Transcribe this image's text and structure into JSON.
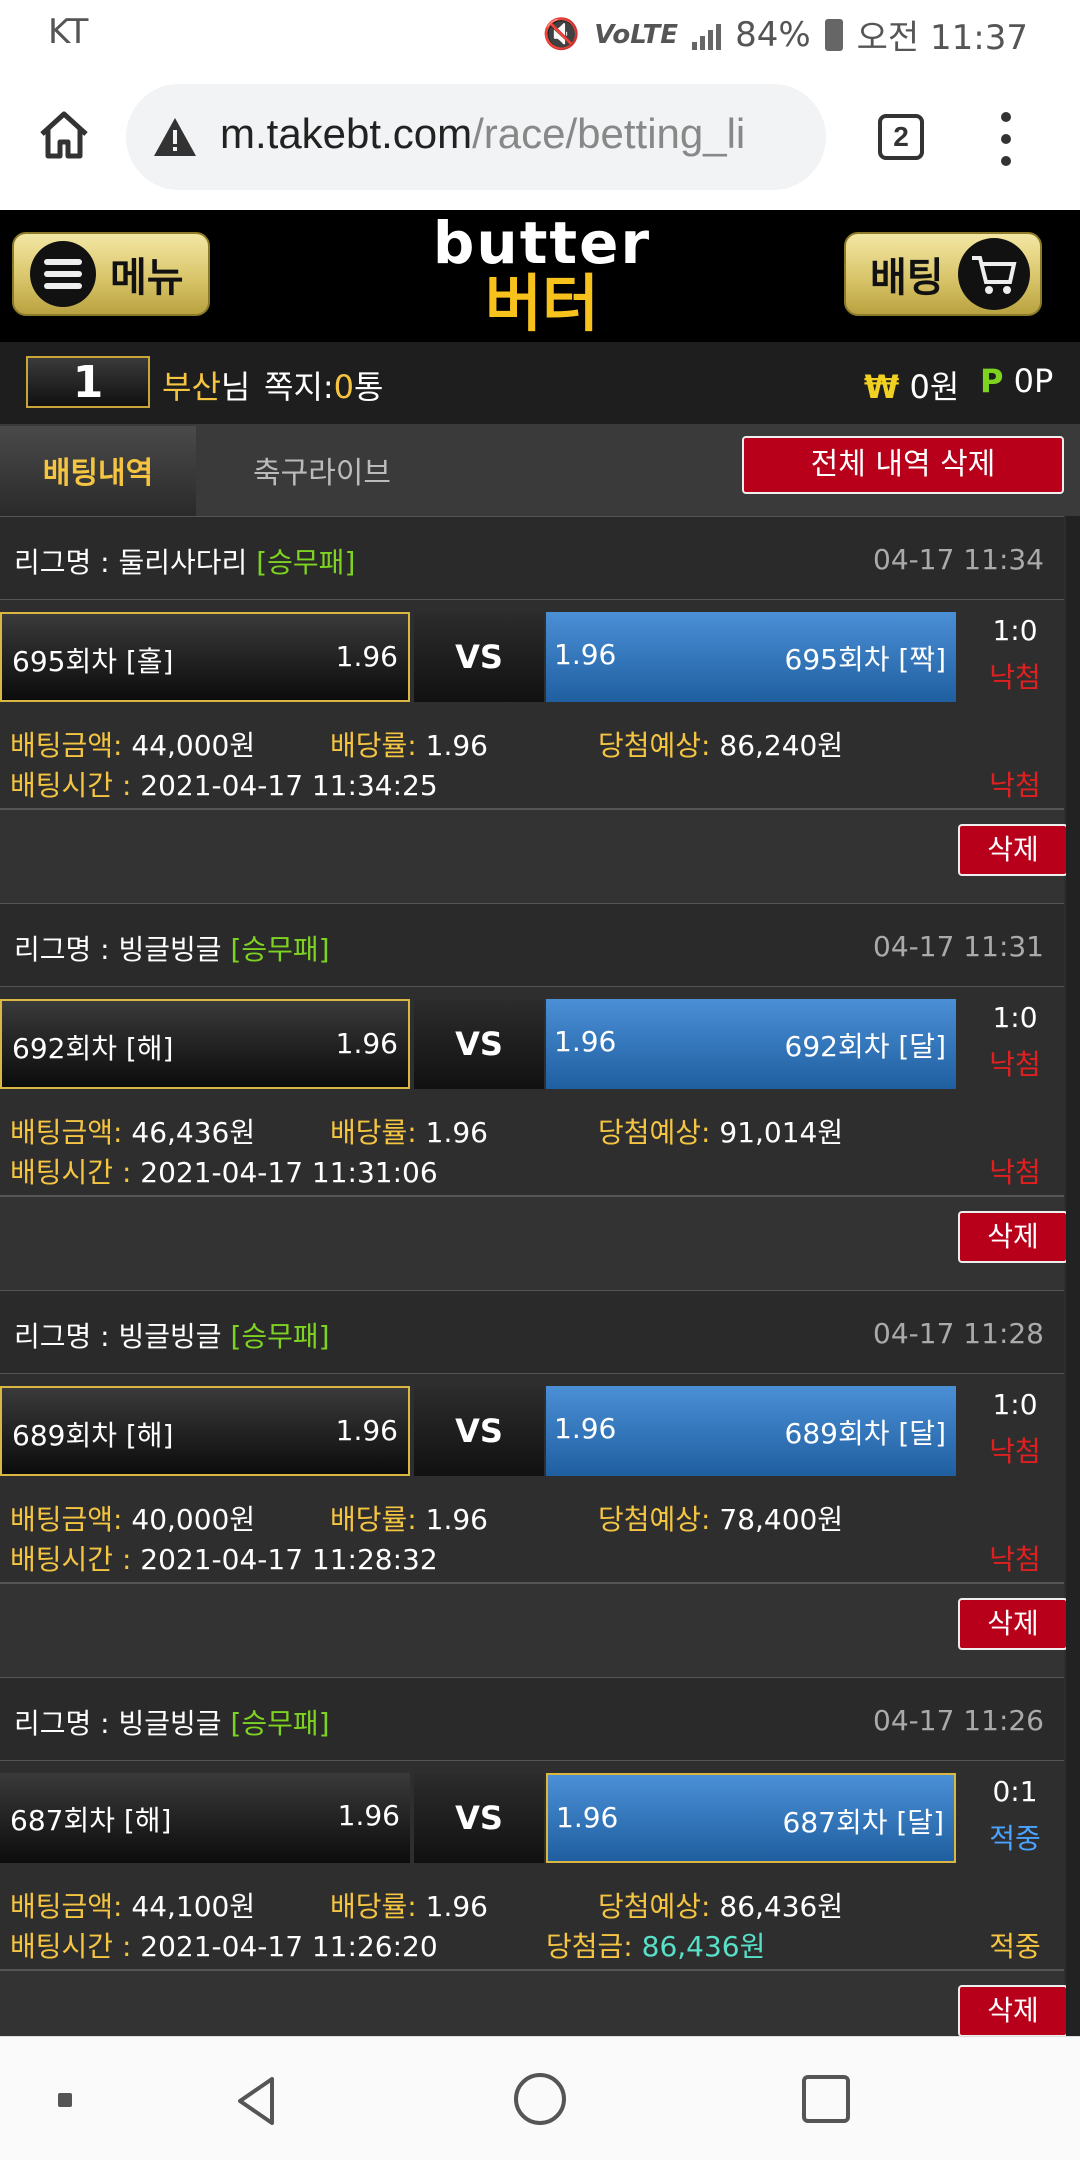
{
  "status_bar": {
    "carrier": "KT",
    "battery": "84%",
    "time": "오전 11:37"
  },
  "browser": {
    "url_host": "m.takebt.com",
    "url_path": "/race/betting_li",
    "tab_count": "2"
  },
  "header": {
    "menu_label": "메뉴",
    "bet_label": "배팅",
    "logo_en": "butter",
    "logo_ko": "버터"
  },
  "user": {
    "level": "1",
    "name": "부산",
    "name_suffix": "님",
    "msg_label": "쪽지:",
    "msg_count": "0",
    "msg_suffix": "통",
    "money_symbol": "₩",
    "money": "0원",
    "points_symbol": "P",
    "points": "0P"
  },
  "tabs": {
    "active": "배팅내역",
    "inactive": "축구라이브",
    "delete_all": "전체 내역 삭제"
  },
  "labels": {
    "league_prefix": "리그명 : ",
    "vs": "VS",
    "amount": "배팅금액:",
    "odds": "배당률:",
    "expected": "당첨예상:",
    "time": "배팅시간 :",
    "payout": "당첨금:",
    "delete": "삭제"
  },
  "bets": [
    {
      "league": "둘리사다리",
      "type": "[승무패]",
      "datetime": "04-17 11:34",
      "left_name": "695회차 [홀]",
      "left_odd": "1.96",
      "right_odd": "1.96",
      "right_name": "695회차 [짝]",
      "score": "1:0",
      "result": "낙첨",
      "amount": "44,000원",
      "odds": "1.96",
      "expected": "86,240원",
      "bet_time": "2021-04-17 11:34:25",
      "status": "낙첨"
    },
    {
      "league": "빙글빙글",
      "type": "[승무패]",
      "datetime": "04-17 11:31",
      "left_name": "692회차 [해]",
      "left_odd": "1.96",
      "right_odd": "1.96",
      "right_name": "692회차 [달]",
      "score": "1:0",
      "result": "낙첨",
      "amount": "46,436원",
      "odds": "1.96",
      "expected": "91,014원",
      "bet_time": "2021-04-17 11:31:06",
      "status": "낙첨"
    },
    {
      "league": "빙글빙글",
      "type": "[승무패]",
      "datetime": "04-17 11:28",
      "left_name": "689회차 [해]",
      "left_odd": "1.96",
      "right_odd": "1.96",
      "right_name": "689회차 [달]",
      "score": "1:0",
      "result": "낙첨",
      "amount": "40,000원",
      "odds": "1.96",
      "expected": "78,400원",
      "bet_time": "2021-04-17 11:28:32",
      "status": "낙첨"
    },
    {
      "league": "빙글빙글",
      "type": "[승무패]",
      "datetime": "04-17 11:26",
      "left_name": "687회차 [해]",
      "left_odd": "1.96",
      "right_odd": "1.96",
      "right_name": "687회차 [달]",
      "score": "0:1",
      "result": "적중",
      "amount": "44,100원",
      "odds": "1.96",
      "expected": "86,436원",
      "bet_time": "2021-04-17 11:26:20",
      "payout": "86,436원",
      "status": "적중"
    }
  ]
}
